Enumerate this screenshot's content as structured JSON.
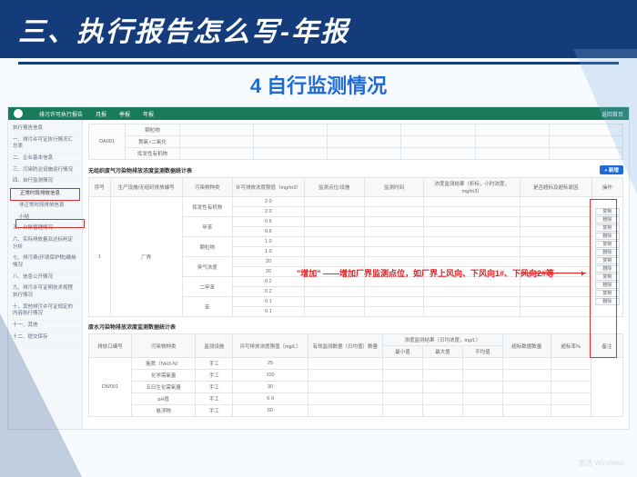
{
  "header": {
    "title": "三、执行报告怎么写-年报"
  },
  "subtitle": "4 自行监测情况",
  "topbar": {
    "app_name": "排污许可执行报告",
    "nav1": "月报",
    "nav2": "季报",
    "nav3": "年报",
    "right": "返回首页"
  },
  "sidebar": {
    "items": [
      "执行报告信息",
      "一、排污许可证执行情况汇总表",
      "二、企业基本信息",
      "三、污染防治设施运行情况",
      "四、自行监测情况",
      "正常时段排放信息",
      "非正常时段排放信息",
      "小结",
      "五、台账管理情况",
      "六、实际排放量及达标判定分析",
      "七、排污费(环境保护税)缴纳情况",
      "八、信息公开情况",
      "九、排污许可证明技术规程执行情况",
      "十、其他排污许可证规定的内容执行情况",
      "十一、其他",
      "十二、提交保存"
    ],
    "active_index": 5
  },
  "top_table": {
    "col0": "DA001",
    "rows": [
      "颗粒物",
      "氮氧×二氧化",
      "挥发性有机物"
    ]
  },
  "section1": {
    "title": "无组织废气污染物排放浓度监测数据统计表",
    "add_btn": "+ 新增",
    "headers": [
      "序号",
      "生产设施/无组织排放编号",
      "污染物种类",
      "许可排放浓度限值（mg/m3）",
      "监测点位/设施",
      "监测时间",
      "浓度监测结果（折标，小时浓度，mg/m3）",
      "是否超标及超标原因",
      "操作"
    ],
    "row_index": "1",
    "row_loc": "厂界",
    "pollutants": [
      {
        "name": "挥发性有机物",
        "vals": [
          "2.0",
          "2.0"
        ]
      },
      {
        "name": "甲苯",
        "vals": [
          "0.6",
          "0.6"
        ]
      },
      {
        "name": "颗粒物",
        "vals": [
          "1.0",
          "1.0"
        ]
      },
      {
        "name": "臭气浓度",
        "vals": [
          "20",
          "20"
        ]
      },
      {
        "name": "二甲苯",
        "vals": [
          "0.2",
          "0.2"
        ]
      },
      {
        "name": "苯",
        "vals": [
          "0.1",
          "0.1"
        ]
      }
    ],
    "ops": [
      "复制",
      "删除"
    ]
  },
  "annotation": {
    "text": "\"增加\" ——增加厂界监测点位，如厂界上风向、下风向1#、下风向2#等"
  },
  "section2": {
    "title": "废水污染物排放浓度监测数据统计表",
    "headers": [
      "排放口编号",
      "污染物种类",
      "监测设施",
      "许可排放浓度限值（mg/L）",
      "有效监测数据（日均值）数量",
      "浓度监测结果（日均浓度，mg/L）",
      "超标数据数量",
      "超标率%",
      "备注"
    ],
    "sub_headers": [
      "最小值",
      "最大值",
      "平均值"
    ],
    "outlet": "DW001",
    "rows": [
      {
        "p": "氨氮（NH3-N）",
        "m": "手工",
        "v": "25"
      },
      {
        "p": "化学需氧量",
        "m": "手工",
        "v": "100"
      },
      {
        "p": "五日生化需氧量",
        "m": "手工",
        "v": "30"
      },
      {
        "p": "pH值",
        "m": "手工",
        "v": "6-9"
      },
      {
        "p": "悬浮物",
        "m": "手工",
        "v": "60"
      }
    ]
  },
  "watermark": "激活 Windows"
}
